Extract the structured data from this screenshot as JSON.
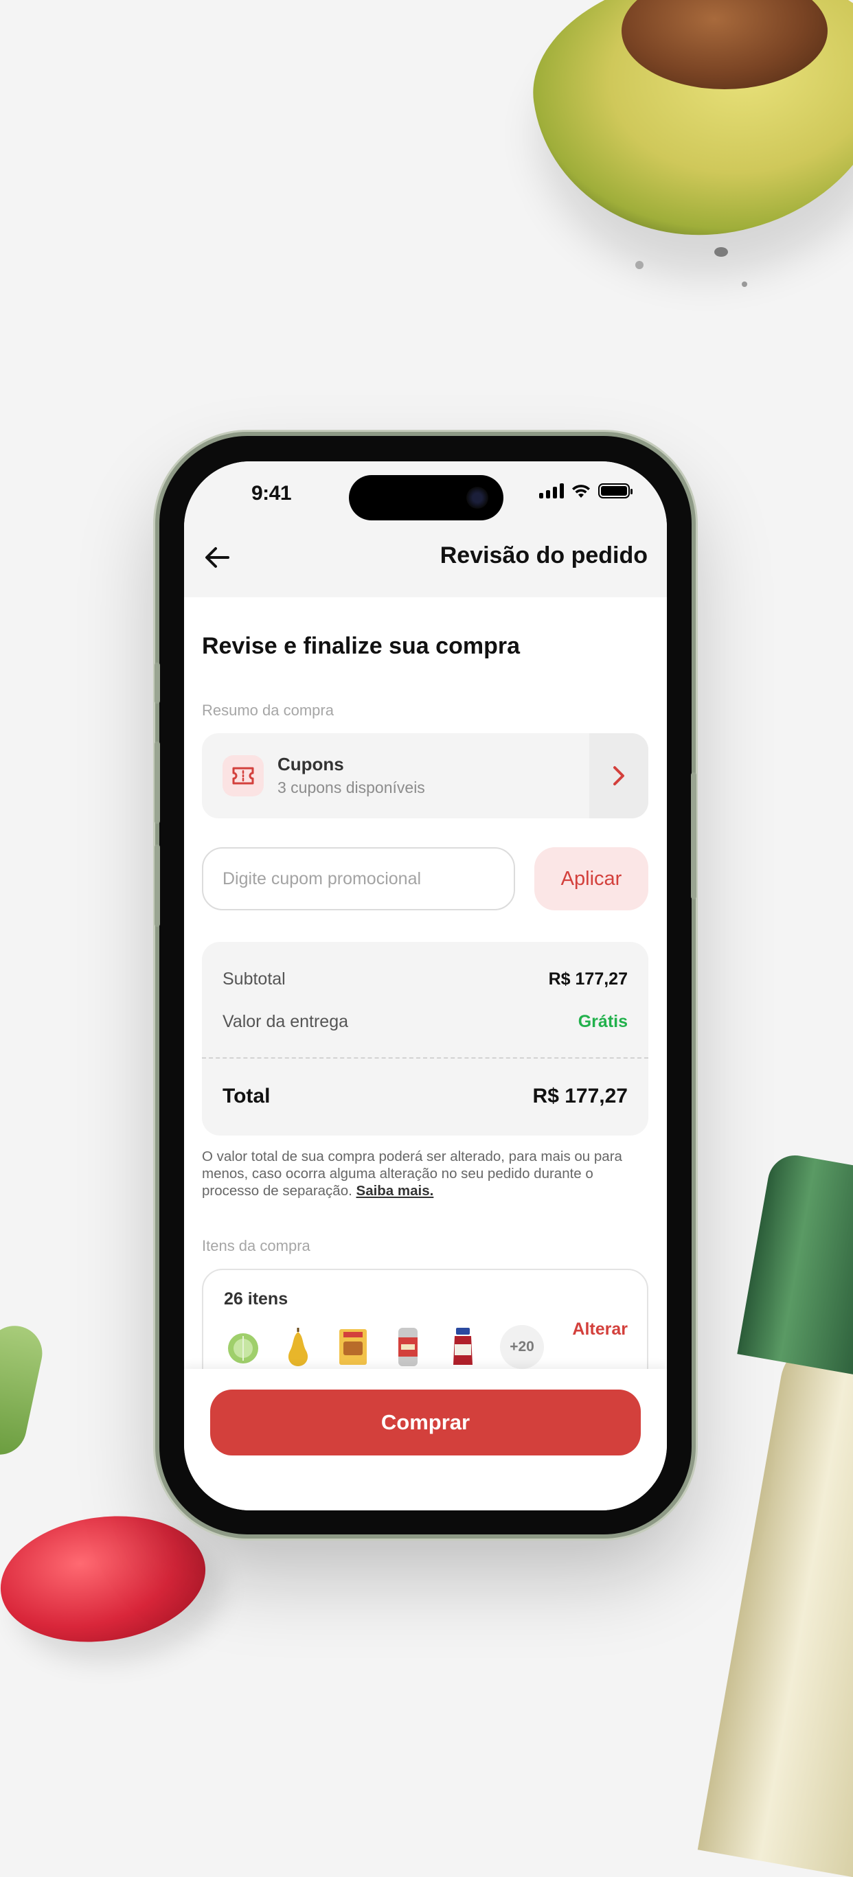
{
  "status_bar": {
    "time": "9:41"
  },
  "header": {
    "title": "Revisão do pedido"
  },
  "main": {
    "heading": "Revise e finalize sua compra",
    "summary_label": "Resumo da compra",
    "coupons": {
      "title": "Cupons",
      "subtitle": "3 cupons disponíveis"
    },
    "promo": {
      "placeholder": "Digite cupom promocional",
      "apply_label": "Aplicar"
    },
    "summary": {
      "subtotal_label": "Subtotal",
      "subtotal_value": "R$ 177,27",
      "delivery_label": "Valor da entrega",
      "delivery_value": "Grátis",
      "total_label": "Total",
      "total_value": "R$ 177,27"
    },
    "note": {
      "text": "O valor total de sua compra poderá ser alterado, para mais ou para menos, caso ocorra alguma alteração no seu pedido durante o processo de separação.",
      "link": "Saiba mais."
    },
    "items_label": "Itens da compra",
    "items": {
      "count_label": "26 itens",
      "change_label": "Alterar",
      "more_label": "+20",
      "thumbs": [
        "lettuce",
        "pear",
        "soup-packet",
        "beer-can",
        "sauce-jar"
      ]
    }
  },
  "footer": {
    "buy_label": "Comprar"
  },
  "colors": {
    "accent": "#d3403c",
    "free": "#22b14c",
    "accent_soft": "#fbe6e6"
  }
}
